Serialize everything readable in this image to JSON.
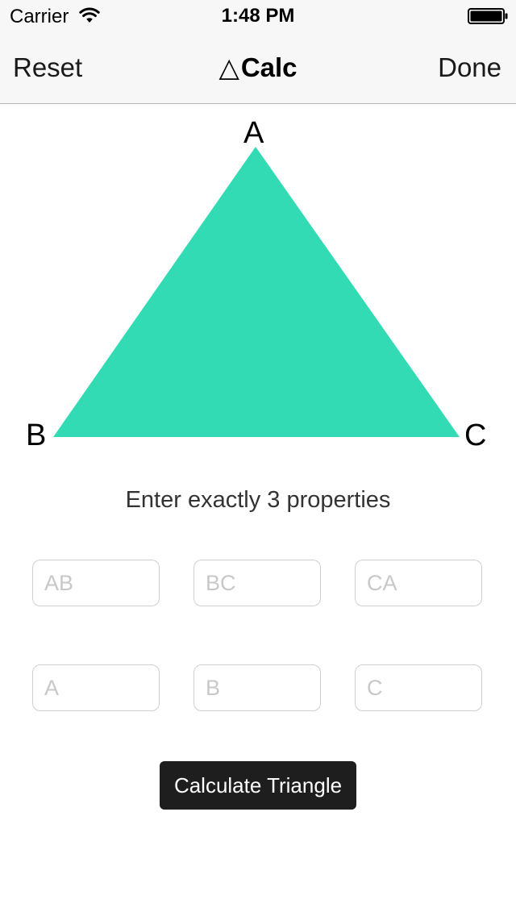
{
  "status_bar": {
    "carrier": "Carrier",
    "time": "1:48 PM",
    "wifi_icon": "wifi-icon",
    "battery_icon": "battery-icon"
  },
  "nav": {
    "reset_label": "Reset",
    "title_glyph": "△",
    "title": "Calc",
    "done_label": "Done"
  },
  "diagram": {
    "triangle_color": "#33dbb5",
    "vertex_a": "A",
    "vertex_b": "B",
    "vertex_c": "C"
  },
  "instructions": "Enter exactly 3 properties",
  "fields": {
    "ab": {
      "placeholder": "AB",
      "value": ""
    },
    "bc": {
      "placeholder": "BC",
      "value": ""
    },
    "ca": {
      "placeholder": "CA",
      "value": ""
    },
    "a": {
      "placeholder": "A",
      "value": ""
    },
    "b": {
      "placeholder": "B",
      "value": ""
    },
    "c": {
      "placeholder": "C",
      "value": ""
    }
  },
  "button": {
    "label": "Calculate Triangle",
    "background": "#1e1e1e"
  }
}
